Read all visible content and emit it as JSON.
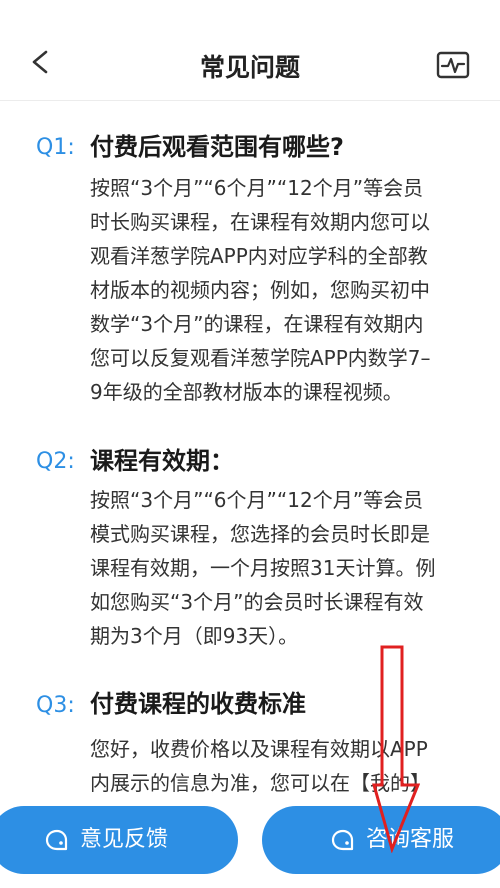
{
  "header": {
    "title": "常见问题",
    "back_icon": "chevron-left-icon",
    "right_icon": "activity-monitor-icon"
  },
  "faqs": [
    {
      "label": "Q1:",
      "title": "付费后观看范围有哪些?",
      "answer_lines": [
        "按照“3个月”“6个月”“12个月”等会员",
        "时长购买课程，在课程有效期内您可以",
        "观看洋葱学院APP内对应学科的全部教",
        "材版本的视频内容；例如，您购买初中",
        "数学“3个月”的课程，在课程有效期内",
        "您可以反复观看洋葱学院APP内数学7–",
        "9年级的全部教材版本的课程视频。"
      ]
    },
    {
      "label": "Q2:",
      "title": "课程有效期：",
      "answer_lines": [
        "按照“3个月”“6个月”“12个月”等会员",
        "模式购买课程，您选择的会员时长即是",
        "课程有效期，一个月按照31天计算。例",
        "如您购买“3个月”的会员时长课程有效",
        "期为3个月（即93天）。"
      ]
    },
    {
      "label": "Q3:",
      "title": "付费课程的收费标准",
      "answer_lines": [
        "您好，收费价格以及课程有效期以APP",
        "内展示的信息为准，您可以在【我的】"
      ]
    }
  ],
  "actions": {
    "feedback_label": "意见反馈",
    "service_label": "咨询客服",
    "feedback_icon": "chat-bubble-icon",
    "service_icon": "chat-bubble-icon"
  },
  "colors": {
    "accent": "#2d8fe4",
    "annotation": "#e02020"
  }
}
